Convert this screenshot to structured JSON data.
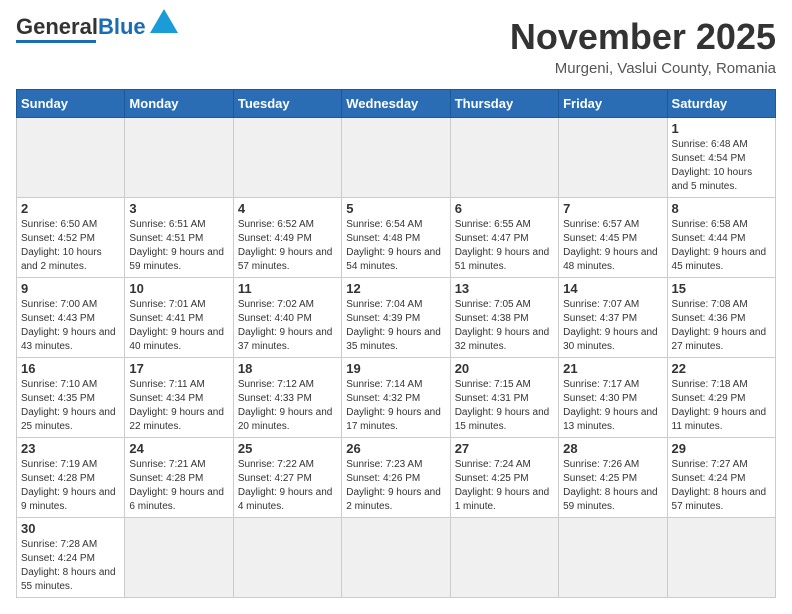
{
  "header": {
    "logo_general": "General",
    "logo_blue": "Blue",
    "title": "November 2025",
    "subtitle": "Murgeni, Vaslui County, Romania"
  },
  "weekdays": [
    "Sunday",
    "Monday",
    "Tuesday",
    "Wednesday",
    "Thursday",
    "Friday",
    "Saturday"
  ],
  "weeks": [
    [
      {
        "day": "",
        "info": ""
      },
      {
        "day": "",
        "info": ""
      },
      {
        "day": "",
        "info": ""
      },
      {
        "day": "",
        "info": ""
      },
      {
        "day": "",
        "info": ""
      },
      {
        "day": "",
        "info": ""
      },
      {
        "day": "1",
        "info": "Sunrise: 6:48 AM\nSunset: 4:54 PM\nDaylight: 10 hours and 5 minutes."
      }
    ],
    [
      {
        "day": "2",
        "info": "Sunrise: 6:50 AM\nSunset: 4:52 PM\nDaylight: 10 hours and 2 minutes."
      },
      {
        "day": "3",
        "info": "Sunrise: 6:51 AM\nSunset: 4:51 PM\nDaylight: 9 hours and 59 minutes."
      },
      {
        "day": "4",
        "info": "Sunrise: 6:52 AM\nSunset: 4:49 PM\nDaylight: 9 hours and 57 minutes."
      },
      {
        "day": "5",
        "info": "Sunrise: 6:54 AM\nSunset: 4:48 PM\nDaylight: 9 hours and 54 minutes."
      },
      {
        "day": "6",
        "info": "Sunrise: 6:55 AM\nSunset: 4:47 PM\nDaylight: 9 hours and 51 minutes."
      },
      {
        "day": "7",
        "info": "Sunrise: 6:57 AM\nSunset: 4:45 PM\nDaylight: 9 hours and 48 minutes."
      },
      {
        "day": "8",
        "info": "Sunrise: 6:58 AM\nSunset: 4:44 PM\nDaylight: 9 hours and 45 minutes."
      }
    ],
    [
      {
        "day": "9",
        "info": "Sunrise: 7:00 AM\nSunset: 4:43 PM\nDaylight: 9 hours and 43 minutes."
      },
      {
        "day": "10",
        "info": "Sunrise: 7:01 AM\nSunset: 4:41 PM\nDaylight: 9 hours and 40 minutes."
      },
      {
        "day": "11",
        "info": "Sunrise: 7:02 AM\nSunset: 4:40 PM\nDaylight: 9 hours and 37 minutes."
      },
      {
        "day": "12",
        "info": "Sunrise: 7:04 AM\nSunset: 4:39 PM\nDaylight: 9 hours and 35 minutes."
      },
      {
        "day": "13",
        "info": "Sunrise: 7:05 AM\nSunset: 4:38 PM\nDaylight: 9 hours and 32 minutes."
      },
      {
        "day": "14",
        "info": "Sunrise: 7:07 AM\nSunset: 4:37 PM\nDaylight: 9 hours and 30 minutes."
      },
      {
        "day": "15",
        "info": "Sunrise: 7:08 AM\nSunset: 4:36 PM\nDaylight: 9 hours and 27 minutes."
      }
    ],
    [
      {
        "day": "16",
        "info": "Sunrise: 7:10 AM\nSunset: 4:35 PM\nDaylight: 9 hours and 25 minutes."
      },
      {
        "day": "17",
        "info": "Sunrise: 7:11 AM\nSunset: 4:34 PM\nDaylight: 9 hours and 22 minutes."
      },
      {
        "day": "18",
        "info": "Sunrise: 7:12 AM\nSunset: 4:33 PM\nDaylight: 9 hours and 20 minutes."
      },
      {
        "day": "19",
        "info": "Sunrise: 7:14 AM\nSunset: 4:32 PM\nDaylight: 9 hours and 17 minutes."
      },
      {
        "day": "20",
        "info": "Sunrise: 7:15 AM\nSunset: 4:31 PM\nDaylight: 9 hours and 15 minutes."
      },
      {
        "day": "21",
        "info": "Sunrise: 7:17 AM\nSunset: 4:30 PM\nDaylight: 9 hours and 13 minutes."
      },
      {
        "day": "22",
        "info": "Sunrise: 7:18 AM\nSunset: 4:29 PM\nDaylight: 9 hours and 11 minutes."
      }
    ],
    [
      {
        "day": "23",
        "info": "Sunrise: 7:19 AM\nSunset: 4:28 PM\nDaylight: 9 hours and 9 minutes."
      },
      {
        "day": "24",
        "info": "Sunrise: 7:21 AM\nSunset: 4:28 PM\nDaylight: 9 hours and 6 minutes."
      },
      {
        "day": "25",
        "info": "Sunrise: 7:22 AM\nSunset: 4:27 PM\nDaylight: 9 hours and 4 minutes."
      },
      {
        "day": "26",
        "info": "Sunrise: 7:23 AM\nSunset: 4:26 PM\nDaylight: 9 hours and 2 minutes."
      },
      {
        "day": "27",
        "info": "Sunrise: 7:24 AM\nSunset: 4:25 PM\nDaylight: 9 hours and 1 minute."
      },
      {
        "day": "28",
        "info": "Sunrise: 7:26 AM\nSunset: 4:25 PM\nDaylight: 8 hours and 59 minutes."
      },
      {
        "day": "29",
        "info": "Sunrise: 7:27 AM\nSunset: 4:24 PM\nDaylight: 8 hours and 57 minutes."
      }
    ],
    [
      {
        "day": "30",
        "info": "Sunrise: 7:28 AM\nSunset: 4:24 PM\nDaylight: 8 hours and 55 minutes."
      },
      {
        "day": "",
        "info": ""
      },
      {
        "day": "",
        "info": ""
      },
      {
        "day": "",
        "info": ""
      },
      {
        "day": "",
        "info": ""
      },
      {
        "day": "",
        "info": ""
      },
      {
        "day": "",
        "info": ""
      }
    ]
  ]
}
